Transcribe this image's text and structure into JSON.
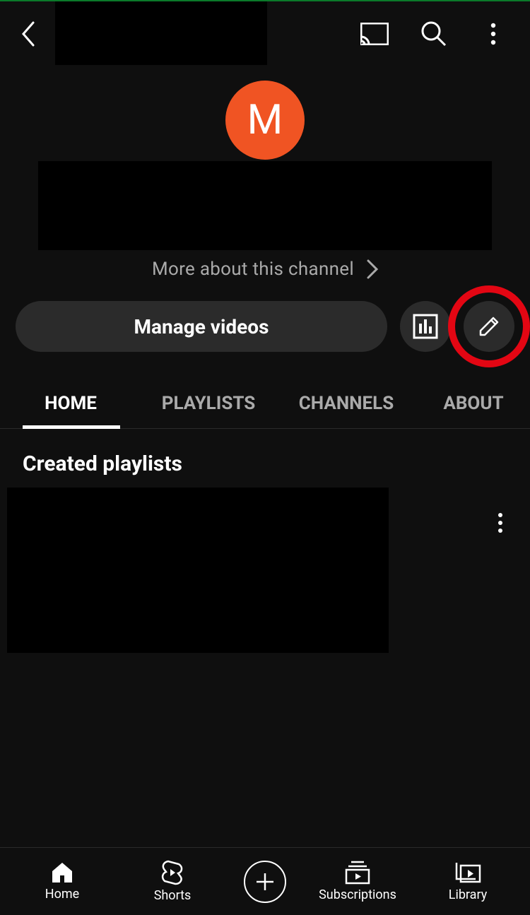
{
  "avatar_letter": "M",
  "more_label": "More about this channel",
  "manage_label": "Manage videos",
  "tabs": {
    "home": "HOME",
    "playlists": "PLAYLISTS",
    "channels": "CHANNELS",
    "about": "ABOUT"
  },
  "section_title": "Created playlists",
  "nav": {
    "home": "Home",
    "shorts": "Shorts",
    "subscriptions": "Subscriptions",
    "library": "Library"
  }
}
